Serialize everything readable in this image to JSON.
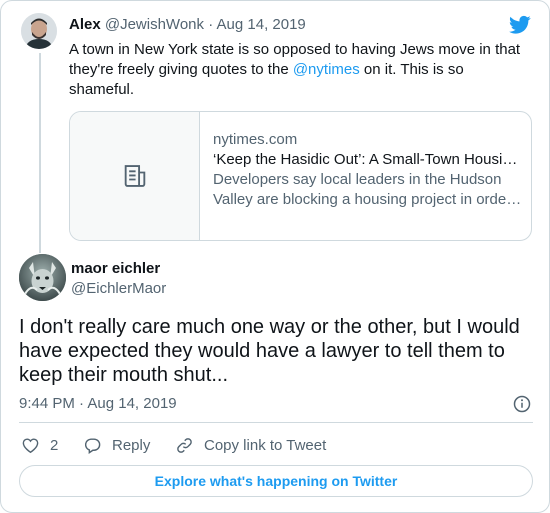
{
  "quoted_tweet": {
    "name": "Alex",
    "handle": "@JewishWonk",
    "separator": "·",
    "date": "Aug 14, 2019",
    "text_before": "A town in New York state is so opposed to having Jews move in that they're freely giving quotes to the ",
    "mention": "@nytimes",
    "text_after": " on it. This is so shameful.",
    "link_card": {
      "domain": "nytimes.com",
      "title": "‘Keep the Hasidic Out’: A Small-Town Housing Fight",
      "desc_line1": "Developers say local leaders in the Hudson",
      "desc_line2": "Valley are blocking a housing project in order to",
      "thumbnail_icon": "article-icon"
    }
  },
  "main_tweet": {
    "name": "maor eichler",
    "handle": "@EichlerMaor",
    "text": "I don't really care much one way or the other, but I would have expected they would have a lawyer to tell them to keep their mouth shut...",
    "time": "9:44 PM",
    "separator": "·",
    "date": "Aug 14, 2019"
  },
  "actions": {
    "like_count": "2",
    "reply_label": "Reply",
    "copy_link_label": "Copy link to Tweet"
  },
  "explore_label": "Explore what's happening on Twitter",
  "colors": {
    "accent": "#1d9bf0",
    "secondary_text": "#536471",
    "border": "#cfd9de"
  }
}
